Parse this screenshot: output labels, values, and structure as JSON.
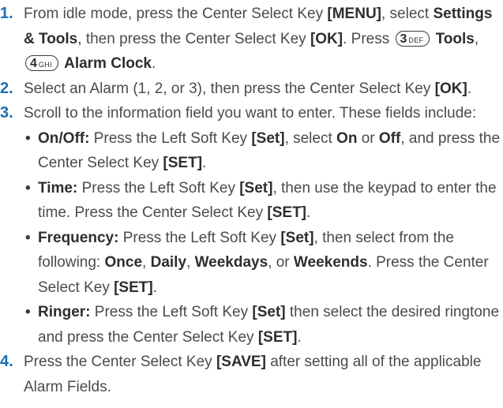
{
  "steps": [
    {
      "num": "1.",
      "a": "From idle mode, press the Center Select Key ",
      "b_menu": "[MENU]",
      "c": ", select ",
      "b_settings": "Settings & Tools",
      "d": ", then press the Center Select Key ",
      "b_ok": "[OK]",
      "e": ". Press ",
      "key1_num": "3",
      "key1_letters": "DEF",
      "f": " ",
      "b_tools": "Tools",
      "g": ", ",
      "key2_num": "4",
      "key2_letters": "GHI",
      "h": " ",
      "b_alarm": "Alarm Clock",
      "i": "."
    },
    {
      "num": "2.",
      "a": "Select an Alarm (1, 2, or 3), then press the Center Select Key ",
      "b_ok": "[OK]",
      "c": "."
    },
    {
      "num": "3.",
      "text": "Scroll to the information field you want to enter. These fields include:",
      "fields": [
        {
          "label": "On/Off:",
          "a": " Press the Left Soft Key ",
          "b_set": "[Set]",
          "c": ", select ",
          "b_on": "On",
          "d": " or ",
          "b_off": "Off",
          "e": ", and press the Center Select Key ",
          "b_set2": "[SET]",
          "f": "."
        },
        {
          "label": "Time:",
          "a": " Press the Left Soft Key ",
          "b_set": "[Set]",
          "c": ", then use the keypad to enter the time. Press the Center Select Key ",
          "b_set2": "[SET]",
          "d": "."
        },
        {
          "label": "Frequency:",
          "a": " Press the Left Soft Key ",
          "b_set": "[Set]",
          "c": ", then select from the following: ",
          "b_once": "Once",
          "d": ", ",
          "b_daily": "Daily",
          "e": ", ",
          "b_weekdays": "Weekdays",
          "f": ", or ",
          "b_weekends": "Weekends",
          "g": ". Press the Center Select Key ",
          "b_set2": "[SET]",
          "h": "."
        },
        {
          "label": "Ringer:",
          "a": " Press the Left Soft Key ",
          "b_set": "[Set]",
          "c": " then select the desired ringtone and press the Center Select Key ",
          "b_set2": "[SET]",
          "d": "."
        }
      ]
    },
    {
      "num": "4.",
      "a": "Press the Center Select Key ",
      "b_save": "[SAVE]",
      "c": " after setting all of the applicable Alarm Fields."
    }
  ],
  "colors": {
    "step_number": "#1a6fb8",
    "body_text": "#4a4a4a",
    "bold_text": "#2e2e2e",
    "background": "#ffffff"
  }
}
